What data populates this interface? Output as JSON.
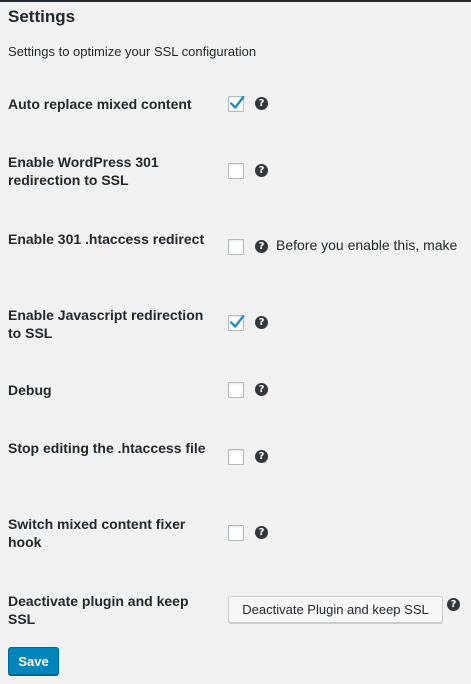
{
  "page": {
    "title": "Settings",
    "subtitle": "Settings to optimize your SSL configuration"
  },
  "settings": [
    {
      "label": "Auto replace mixed content",
      "checked": true
    },
    {
      "label": "Enable WordPress 301 redirection to SSL",
      "checked": false
    },
    {
      "label": "Enable 301 .htaccess redirect",
      "checked": false,
      "help_text": "Before you enable this, make"
    },
    {
      "label": "Enable Javascript redirection to SSL",
      "checked": true
    },
    {
      "label": "Debug",
      "checked": false
    },
    {
      "label": "Stop editing the .htaccess file",
      "checked": false
    },
    {
      "label": "Switch mixed content fixer hook",
      "checked": false
    },
    {
      "label": "Deactivate plugin and keep SSL",
      "button_label": "Deactivate Plugin and keep SSL"
    }
  ],
  "help_icon_glyph": "?",
  "save_label": "Save",
  "colors": {
    "accent": "#0085ba",
    "checkmark": "#1e8cbe",
    "background": "#f1f1f1",
    "text": "#23282d"
  }
}
